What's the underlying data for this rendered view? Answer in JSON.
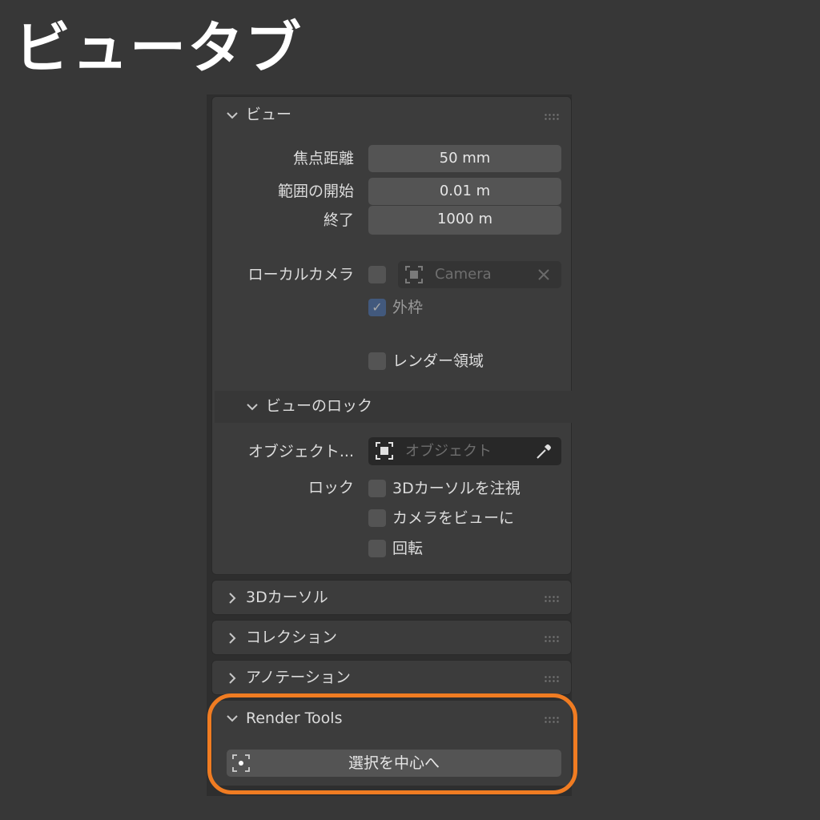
{
  "page_title": "ビュータブ",
  "view_panel": {
    "title": "ビュー",
    "focal_length": {
      "label": "焦点距離",
      "value": "50 mm"
    },
    "clip_start": {
      "label": "範囲の開始",
      "value": "0.01 m"
    },
    "clip_end": {
      "label": "終了",
      "value": "1000 m"
    },
    "local_camera": {
      "label": "ローカルカメラ",
      "checked": false,
      "camera_value": "Camera"
    },
    "outline": {
      "label": "外枠",
      "checked": true
    },
    "render_region": {
      "label": "レンダー領域",
      "checked": false
    }
  },
  "view_lock": {
    "title": "ビューのロック",
    "object": {
      "label": "オブジェクト...",
      "placeholder": "オブジェクト"
    },
    "lock": {
      "label": "ロック",
      "options": [
        {
          "label": "3Dカーソルを注視",
          "checked": false
        },
        {
          "label": "カメラをビューに",
          "checked": false
        },
        {
          "label": "回転",
          "checked": false
        }
      ]
    }
  },
  "collapsed_panels": [
    {
      "title": "3Dカーソル"
    },
    {
      "title": "コレクション"
    },
    {
      "title": "アノテーション"
    }
  ],
  "render_tools": {
    "title": "Render Tools",
    "button_label": "選択を中心へ"
  },
  "colors": {
    "highlight": "#f07c22",
    "checkbox_checked": "#4772b3"
  },
  "icons": [
    "chevron-down-icon",
    "chevron-right-icon",
    "drag-grip-icon",
    "camera-icon",
    "clear-x-icon",
    "object-icon",
    "eyedropper-icon",
    "focus-selection-icon",
    "checkmark-icon"
  ]
}
